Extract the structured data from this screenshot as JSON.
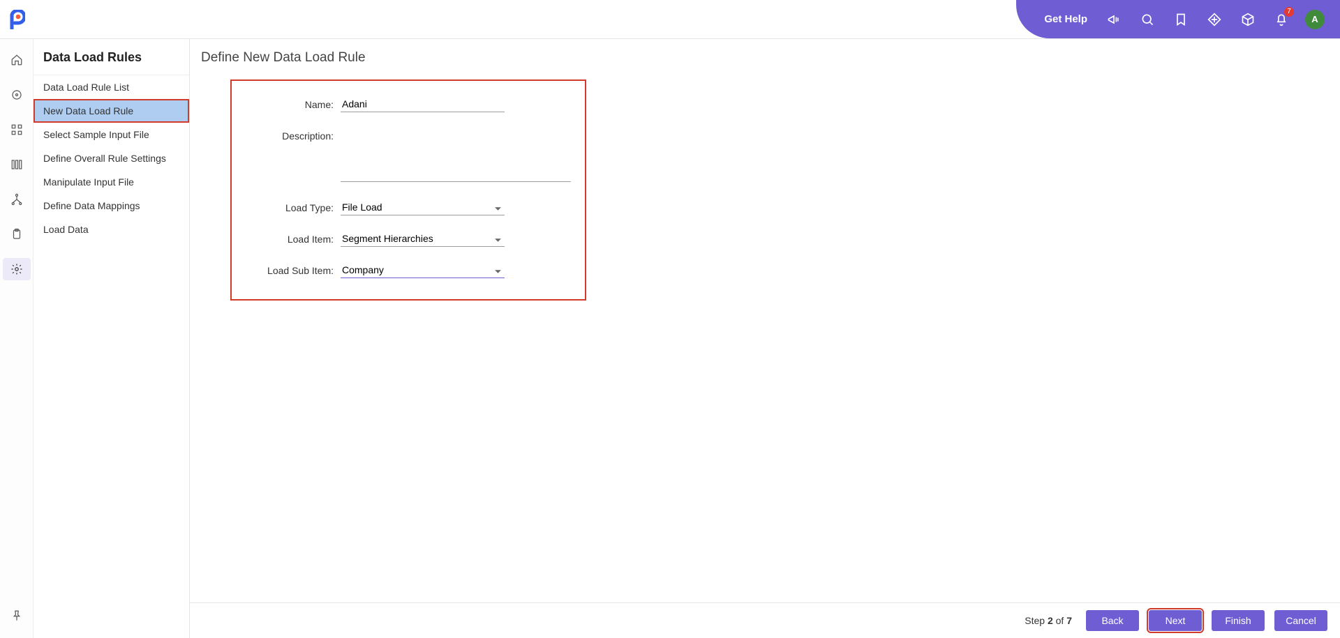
{
  "header": {
    "get_help": "Get Help",
    "notification_count": "7",
    "avatar_initial": "A"
  },
  "sidebar": {
    "title": "Data Load Rules",
    "items": [
      {
        "label": "Data Load Rule List"
      },
      {
        "label": "New Data Load Rule"
      },
      {
        "label": "Select Sample Input File"
      },
      {
        "label": "Define Overall Rule Settings"
      },
      {
        "label": "Manipulate Input File"
      },
      {
        "label": "Define Data Mappings"
      },
      {
        "label": "Load Data"
      }
    ]
  },
  "main": {
    "heading": "Define New Data Load Rule",
    "labels": {
      "name": "Name:",
      "description": "Description:",
      "load_type": "Load Type:",
      "load_item": "Load Item:",
      "load_sub_item": "Load Sub Item:"
    },
    "values": {
      "name": "Adani",
      "description": "",
      "load_type": "File Load",
      "load_item": "Segment Hierarchies",
      "load_sub_item": "Company"
    }
  },
  "footer": {
    "step_prefix": "Step ",
    "step_current": "2",
    "step_mid": " of ",
    "step_total": "7",
    "back": "Back",
    "next": "Next",
    "finish": "Finish",
    "cancel": "Cancel"
  }
}
